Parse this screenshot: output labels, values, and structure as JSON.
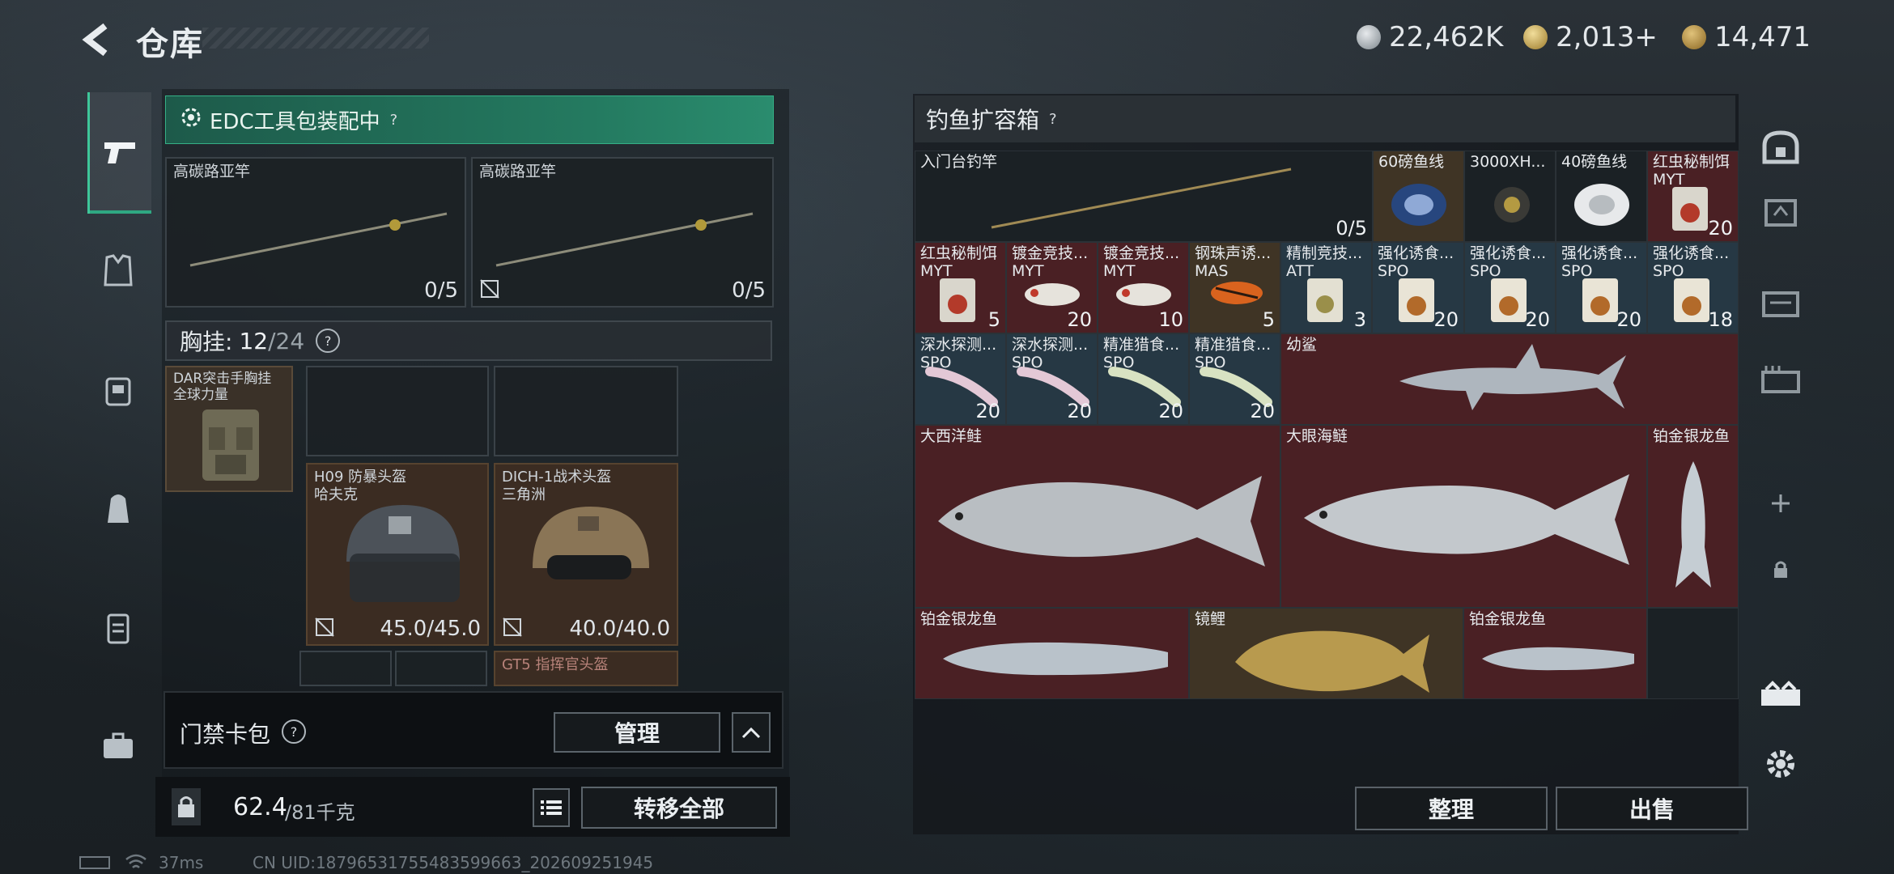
{
  "header": {
    "title": "仓库",
    "currencies": [
      {
        "icon": "silver-coin-icon",
        "value": "22,462K"
      },
      {
        "icon": "gold-triangle-coin-icon",
        "value": "2,013+"
      },
      {
        "icon": "bronze-coin-icon",
        "value": "14,471"
      }
    ]
  },
  "left": {
    "edc_label": "EDC工具包装配中",
    "rod_slots": [
      {
        "name": "高碳路亚竿",
        "count": "0/5"
      },
      {
        "name": "高碳路亚竿",
        "count": "0/5"
      }
    ],
    "chest": {
      "label": "胸挂:",
      "used": "12",
      "max": "/24"
    },
    "chest_item": {
      "name1": "DAR突击手胸挂",
      "name2": "全球力量"
    },
    "helmets": [
      {
        "name1": "H09 防暴头盔",
        "name2": "哈夫克",
        "durability": "45.0/45.0"
      },
      {
        "name1": "DICH-1战术头盔",
        "name2": "三角洲",
        "durability": "40.0/40.0"
      }
    ],
    "partial_item": "GT5 指挥官头盔",
    "card_label": "门禁卡包",
    "manage": "管理",
    "weight_value": "62.4",
    "weight_max": "/81千克",
    "transfer_all": "转移全部"
  },
  "right": {
    "title": "钓鱼扩容箱",
    "items": {
      "rod": {
        "name": "入门台钓竿",
        "count": "0/5"
      },
      "line60": {
        "name": "60磅鱼线"
      },
      "reel": {
        "name": "3000XH..."
      },
      "line40": {
        "name": "40磅鱼线"
      },
      "bait_red1": {
        "name1": "红虫秘制饵",
        "name2": "MYT",
        "count": "20"
      },
      "bait_red2": {
        "name1": "红虫秘制饵",
        "name2": "MYT",
        "count": "5"
      },
      "lure_gold1": {
        "name1": "镀金竞技...",
        "name2": "MYT",
        "count": "20"
      },
      "lure_gold2": {
        "name1": "镀金竞技...",
        "name2": "MYT",
        "count": "10"
      },
      "lure_steel": {
        "name1": "钢珠声诱...",
        "name2": "MAS",
        "count": "5"
      },
      "bait_fine": {
        "name1": "精制竞技...",
        "name2": "ATT",
        "count": "3"
      },
      "lure_enh": [
        {
          "name1": "强化诱食...",
          "name2": "SPO",
          "count": "20"
        },
        {
          "name1": "强化诱食...",
          "name2": "SPO",
          "count": "20"
        },
        {
          "name1": "强化诱食...",
          "name2": "SPO",
          "count": "20"
        },
        {
          "name1": "强化诱食...",
          "name2": "SPO",
          "count": "18"
        }
      ],
      "lure_deep": [
        {
          "name1": "深水探测...",
          "name2": "SPO",
          "count": "20"
        },
        {
          "name1": "深水探测...",
          "name2": "SPO",
          "count": "20"
        }
      ],
      "lure_hunt": [
        {
          "name1": "精准猎食...",
          "name2": "SPO",
          "count": "20"
        },
        {
          "name1": "精准猎食...",
          "name2": "SPO",
          "count": "20"
        }
      ],
      "shark": {
        "name": "幼鲨"
      },
      "salmon": {
        "name": "大西洋鲑"
      },
      "tarpon": {
        "name": "大眼海鲢"
      },
      "arowana_v": {
        "name": "铂金银龙鱼"
      },
      "arowana1": {
        "name": "铂金银龙鱼"
      },
      "carp": {
        "name": "镜鲤"
      },
      "arowana2": {
        "name": "铂金银龙鱼"
      }
    },
    "sort": "整理",
    "sell": "出售"
  },
  "status": {
    "ping": "37ms",
    "uid": "CN UID:18796531755483599663_202609251945"
  },
  "colors": {
    "accent_green": "#2fa882",
    "red_cell": "#4a2024",
    "blue_cell": "#263844"
  }
}
